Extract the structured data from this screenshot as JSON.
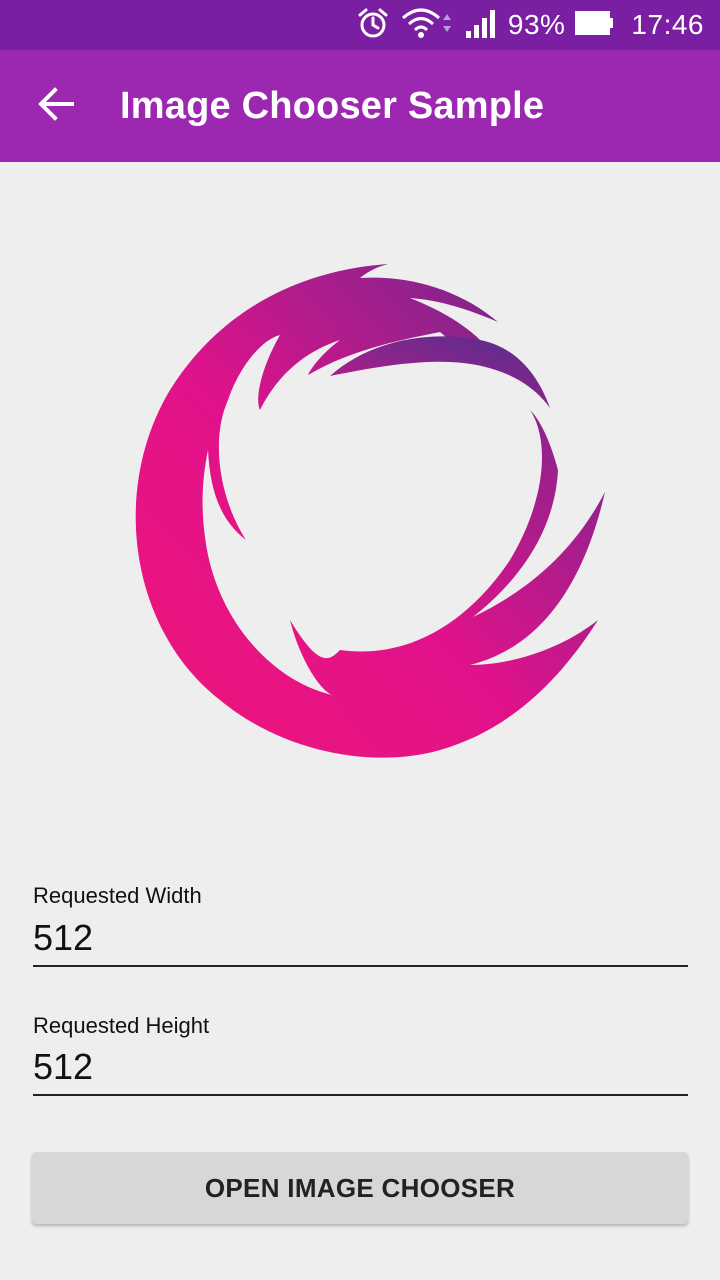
{
  "status_bar": {
    "battery_percent": "93%",
    "time": "17:46",
    "icons": [
      "alarm-icon",
      "wifi-icon",
      "signal-icon",
      "battery-icon"
    ]
  },
  "app_bar": {
    "title": "Image Chooser Sample",
    "back_icon": "arrow-back-icon",
    "color": "#9c27b0",
    "status_color": "#7b1fa2"
  },
  "form": {
    "width_label": "Requested Width",
    "width_value": "512",
    "height_label": "Requested Height",
    "height_value": "512"
  },
  "button": {
    "label": "OPEN IMAGE CHOOSER"
  },
  "colors": {
    "logo_pink": "#f0157a",
    "logo_purple": "#5b2d8e",
    "background": "#eeeeee"
  }
}
